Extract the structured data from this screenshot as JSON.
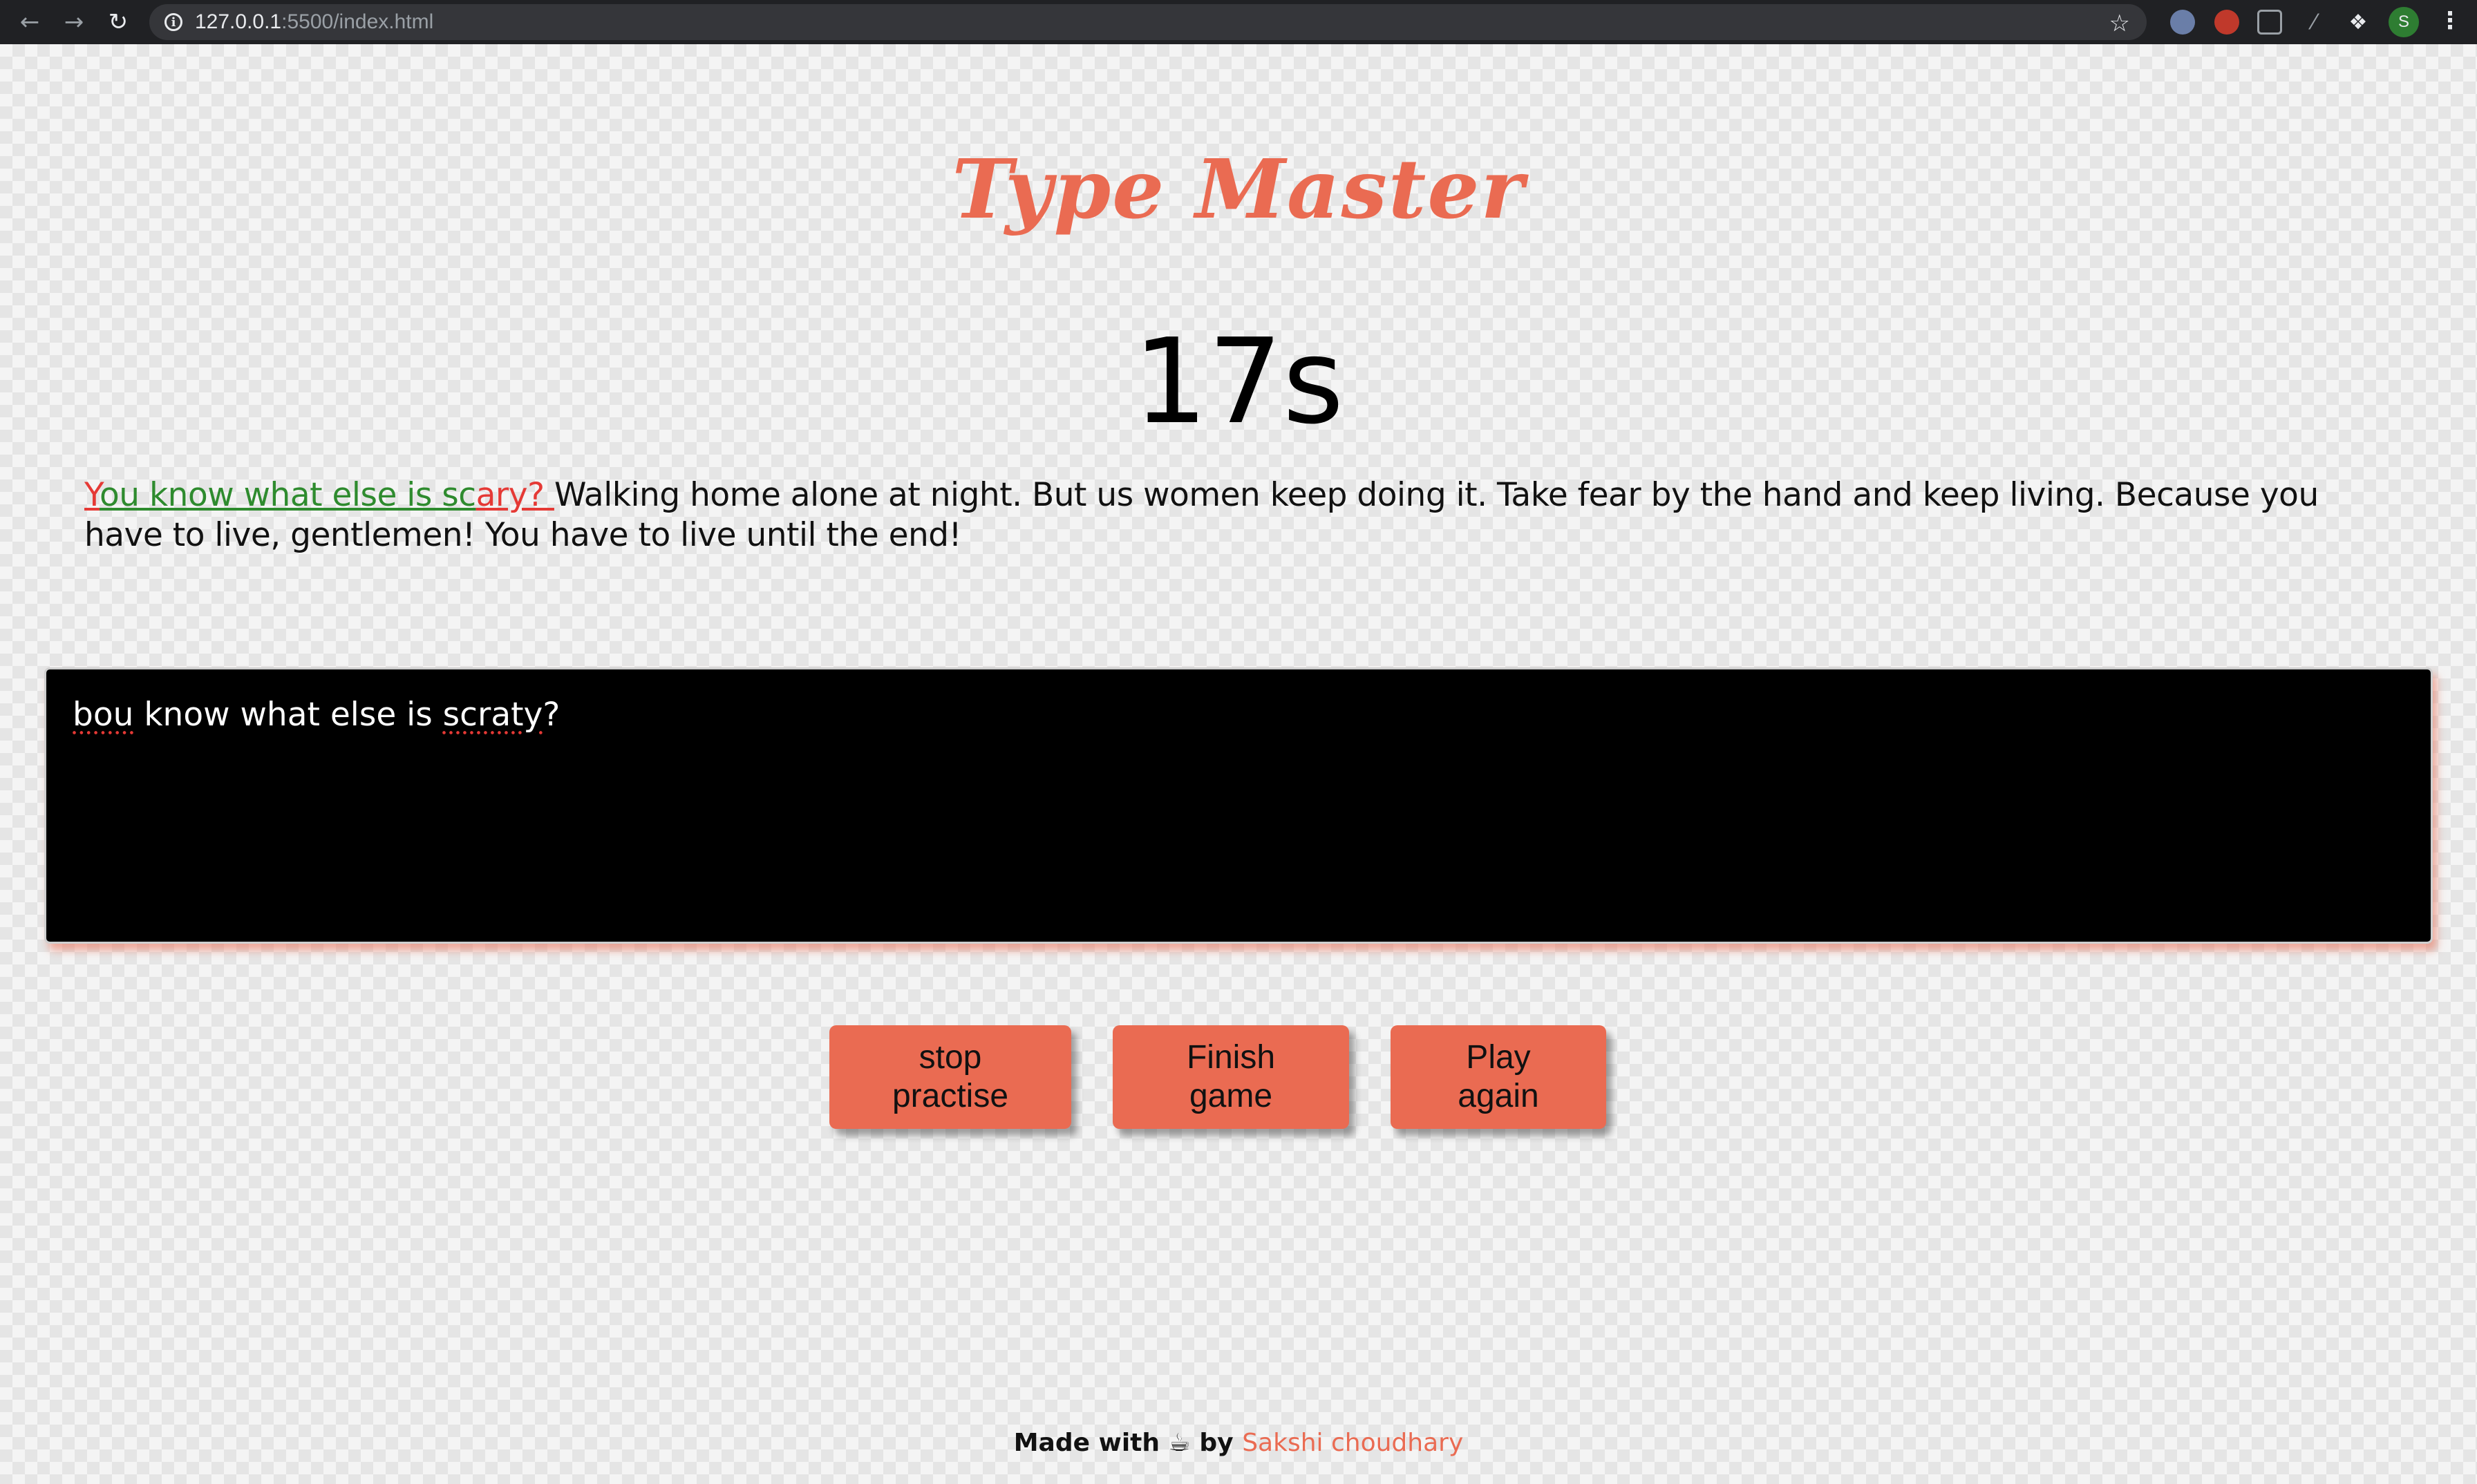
{
  "browser": {
    "url_host": "127.0.0.1",
    "url_rest": ":5500/index.html",
    "profile_initial": "S"
  },
  "app": {
    "title": "Type Master",
    "timer": "17s"
  },
  "quote": {
    "segments": [
      {
        "text": "Y",
        "status": "incorrect"
      },
      {
        "text": "ou know what else is sc",
        "status": "correct"
      },
      {
        "text": "ary? ",
        "status": "incorrect"
      },
      {
        "text": "Walking home alone at night. But us women keep doing it. Take fear by the hand and keep living. Because you have to live, gentlemen! You have to live until the end!",
        "status": "pending"
      }
    ]
  },
  "input": {
    "segments": [
      {
        "text": "bou",
        "misspelled": true
      },
      {
        "text": " know what else is ",
        "misspelled": false
      },
      {
        "text": "scraty",
        "misspelled": true
      },
      {
        "text": "?",
        "misspelled": false
      }
    ]
  },
  "buttons": {
    "stop_line1": "stop",
    "stop_line2": "practise",
    "finish_line1": "Finish",
    "finish_line2": "game",
    "play_line1": "Play",
    "play_line2": "again"
  },
  "footer": {
    "prefix": "Made with",
    "icon": "coffee-icon",
    "by": "by",
    "author": "Sakshi choudhary"
  },
  "colors": {
    "accent": "#ea6b52",
    "correct": "#2e8b2e",
    "incorrect": "#e53935"
  }
}
